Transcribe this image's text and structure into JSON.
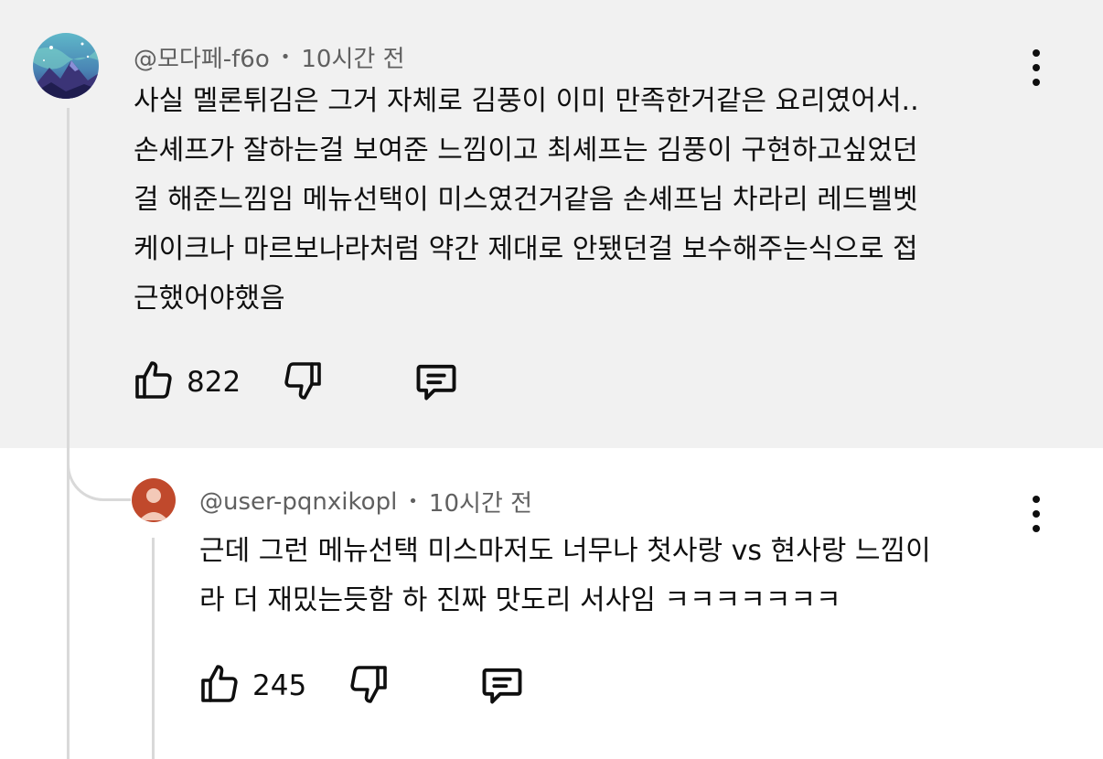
{
  "comment": {
    "author": "@모다페-f6o",
    "separator": "•",
    "time": "10시간 전",
    "lines": [
      "사실 멜론튀김은 그거 자체로 김풍이 이미 만족한거같은 요리였어서..",
      "손셰프가 잘하는걸 보여준 느낌이고 최셰프는 김풍이 구현하고싶었던",
      "걸 해준느낌임 메뉴선택이 미스였건거같음 손셰프님 차라리 레드벨벳",
      "케이크나 마르보나라처럼 약간 제대로 안됐던걸 보수해주는식으로 접",
      "근했어야했음"
    ],
    "likes": "822",
    "avatar_icon": "galaxy-mountain-icon"
  },
  "reply": {
    "author": "@user-pqnxikopl",
    "separator": "•",
    "time": "10시간 전",
    "lines": [
      "근데 그런 메뉴선택 미스마저도 너무나 첫사랑 vs 현사랑 느낌이",
      "라 더 재밌는듯함 하 진짜 맛도리 서사임 ㅋㅋㅋㅋㅋㅋㅋ"
    ],
    "likes": "245",
    "avatar_icon": "person-icon",
    "avatar_color": "#c0492c"
  },
  "colors": {
    "highlight_bg": "#f1f1f1",
    "meta_text": "#606060",
    "thread_line": "#d9d9d9"
  }
}
